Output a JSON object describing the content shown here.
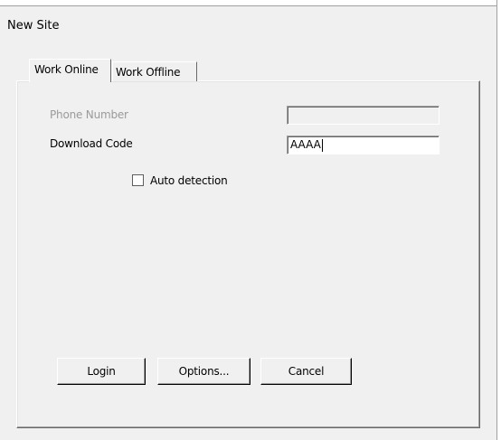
{
  "window": {
    "title": "New Site"
  },
  "tabs": [
    {
      "label": "Work Online",
      "active": true
    },
    {
      "label": "Work Offline",
      "active": false
    }
  ],
  "form": {
    "phone_number": {
      "label": "Phone Number",
      "value": "",
      "enabled": false
    },
    "download_code": {
      "label": "Download Code",
      "value": "AAAA",
      "enabled": true
    },
    "auto_detection": {
      "label": "Auto detection",
      "checked": false
    }
  },
  "buttons": {
    "login": "Login",
    "options": "Options...",
    "cancel": "Cancel"
  }
}
